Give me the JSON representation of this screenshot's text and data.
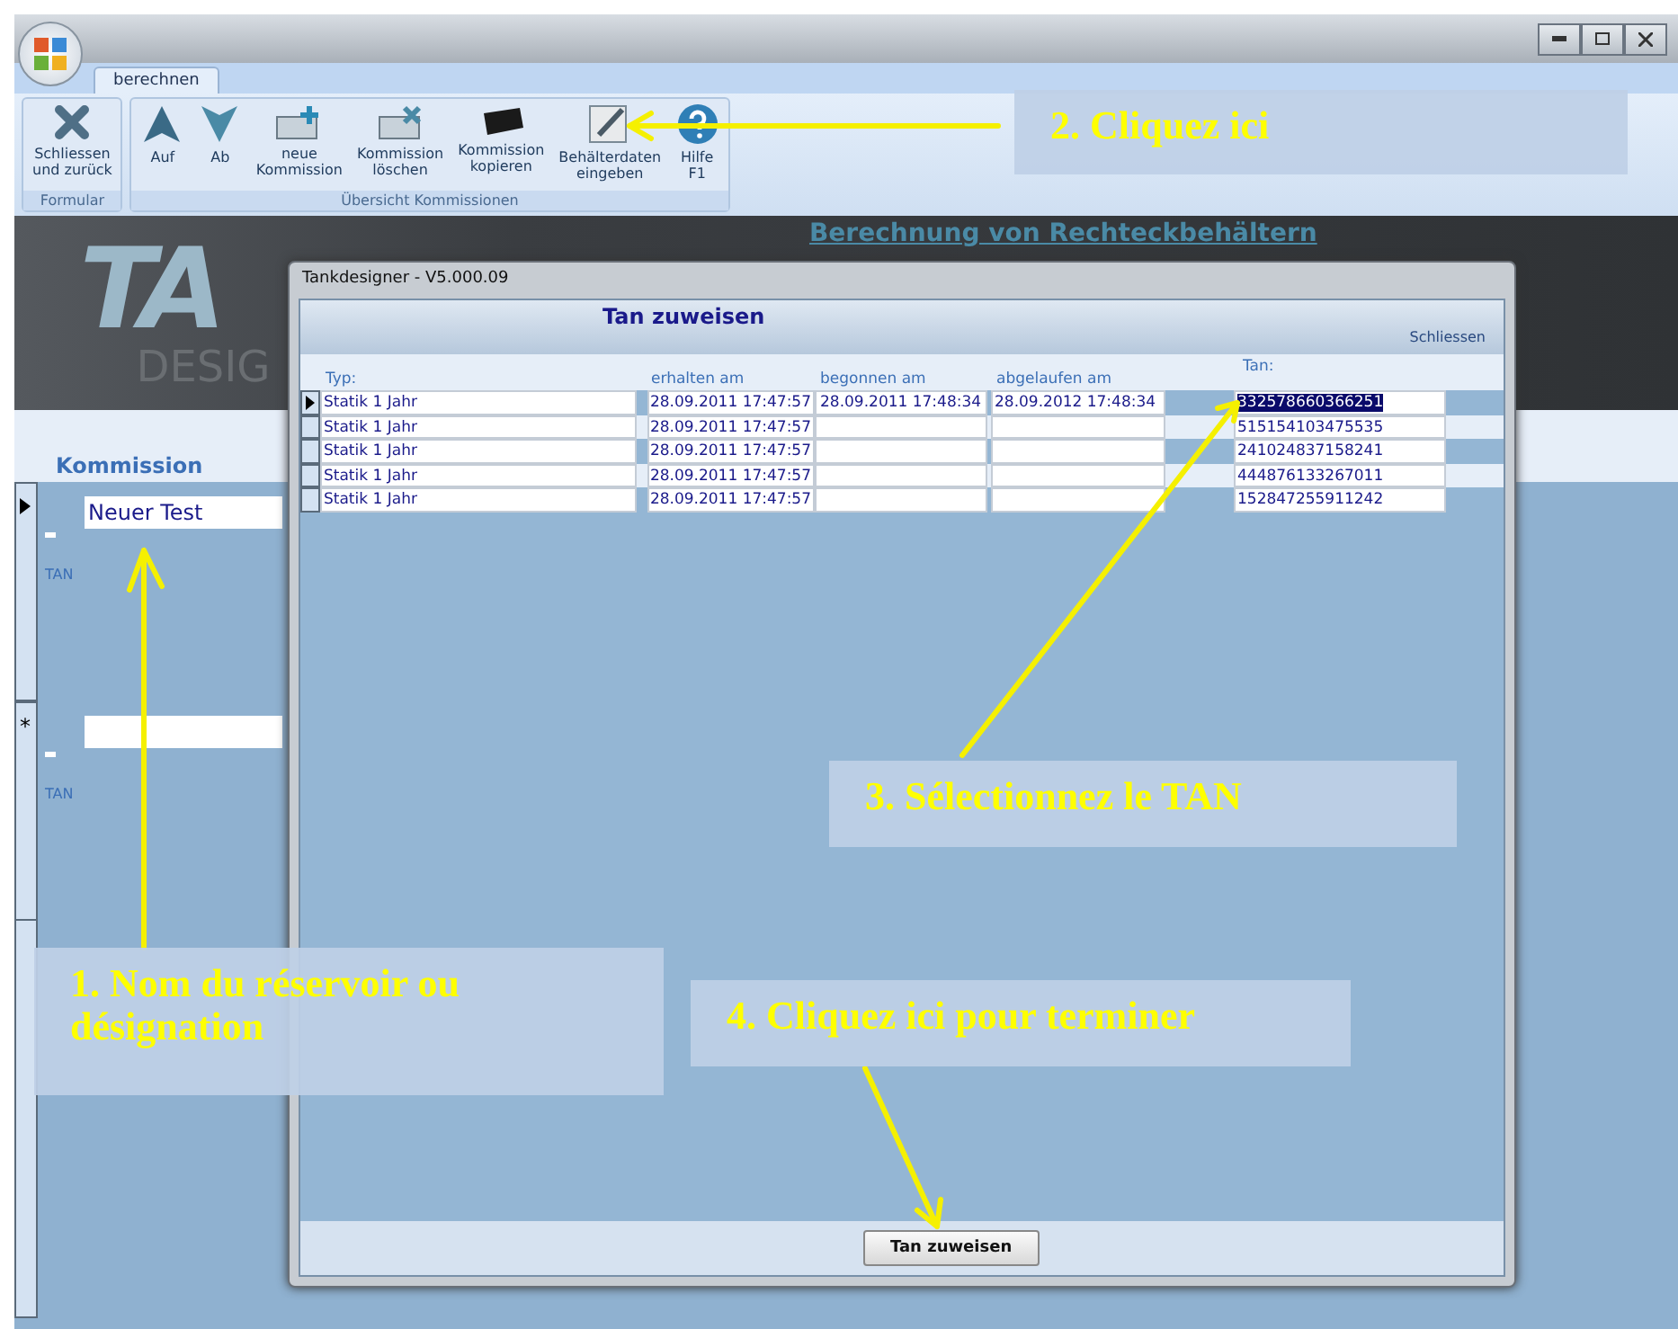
{
  "app": {
    "tabs": [
      {
        "label": "berechnen",
        "selected": true
      }
    ],
    "ribbon": [
      {
        "label": "Formular",
        "buttons": [
          {
            "kind": "close",
            "label": "Schliessen\nund zurück"
          }
        ]
      },
      {
        "label": "Übersicht Kommissionen",
        "buttons": [
          {
            "kind": "up",
            "label": "Auf"
          },
          {
            "kind": "down",
            "label": "Ab"
          },
          {
            "kind": "new",
            "label": "neue\nKommission"
          },
          {
            "kind": "delete",
            "label": "Kommission\nlöschen"
          },
          {
            "kind": "copy",
            "label": "Kommission\nkopieren"
          },
          {
            "kind": "edit",
            "label": "Behälterdaten\neingeben"
          },
          {
            "kind": "help",
            "label": "Hilfe\nF1"
          }
        ]
      }
    ],
    "header_link": "Berechnung von Rechteckbehältern",
    "logo": {
      "letters": "TA",
      "subtitle": "DESIG"
    },
    "section_label": "Kommission",
    "records": [
      {
        "kind": "current",
        "name": "Neuer Test",
        "tan_label": "TAN"
      },
      {
        "kind": "new",
        "marker": "*",
        "tan_label": "TAN"
      }
    ]
  },
  "dialog": {
    "title": "Tankdesigner - V5.000.09",
    "heading": "Tan zuweisen",
    "close_link": "Schliessen",
    "columns": [
      "Typ:",
      "erhalten am",
      "begonnen am",
      "abgelaufen am",
      "Tan:"
    ],
    "rows": [
      {
        "selected": true,
        "type": "Statik 1 Jahr",
        "received": "28.09.2011 17:47:57",
        "started": "28.09.2011 17:48:34",
        "expires": "28.09.2012 17:48:34",
        "tan": "332578660366251"
      },
      {
        "selected": false,
        "type": "Statik 1 Jahr",
        "received": "28.09.2011 17:47:57",
        "tan": "515154103475535"
      },
      {
        "selected": false,
        "type": "Statik 1 Jahr",
        "received": "28.09.2011 17:47:57",
        "tan": "241024837158241"
      },
      {
        "selected": false,
        "type": "Statik 1 Jahr",
        "received": "28.09.2011 17:47:57",
        "tan": "444876133267011"
      },
      {
        "selected": false,
        "type": "Statik 1 Jahr",
        "received": "28.09.2011 17:47:57",
        "tan": "152847255911242"
      }
    ],
    "button": "Tan zuweisen"
  },
  "annotations": [
    {
      "text": "2. Cliquez ici"
    },
    {
      "text": "3. Sélectionnez le TAN"
    },
    {
      "text": "1. Nom du réservoir ou\ndésignation"
    },
    {
      "text": "4. Cliquez ici pour terminer"
    }
  ]
}
